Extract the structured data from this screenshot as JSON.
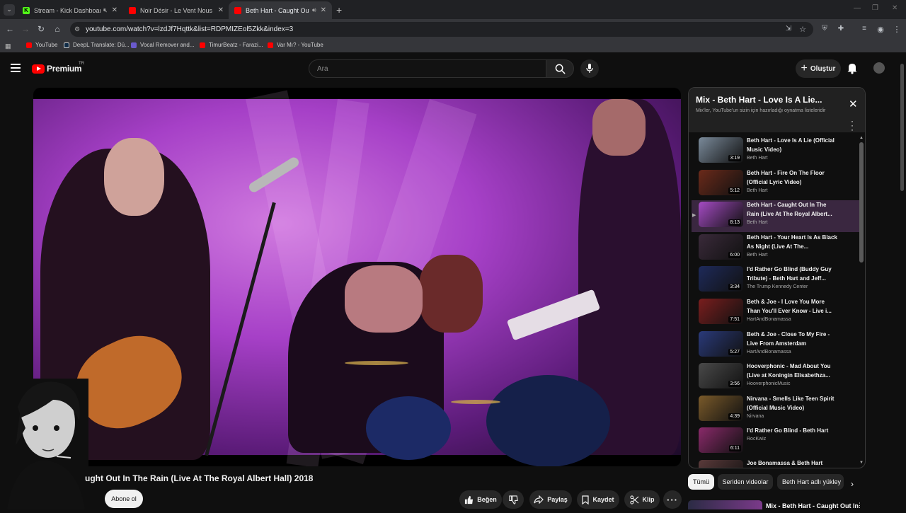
{
  "browser": {
    "tabs": [
      {
        "title": "Stream - Kick Dashboard",
        "favicon_color": "#53fc18",
        "favicon_letter": "K"
      },
      {
        "title": "Noir Désir - Le Vent Nous Porte",
        "favicon_color": "#ff0000"
      },
      {
        "title": "Beth Hart - Caught Out In The Rain",
        "favicon_color": "#ff0000",
        "active": true
      }
    ],
    "url": "youtube.com/watch?v=lzdJf7Hqttk&list=RDPMIZEol5Zkk&index=3",
    "bookmarks": [
      {
        "label": "YouTube",
        "color": "#ff0000"
      },
      {
        "label": "DeepL Translate: Dü...",
        "color": "#0f2b46"
      },
      {
        "label": "Vocal Remover and...",
        "color": "#6a5acd"
      },
      {
        "label": "TimurBeatz - Farazi...",
        "color": "#ff0000"
      },
      {
        "label": "Var Mı? - YouTube",
        "color": "#ff0000"
      }
    ]
  },
  "header": {
    "logo_text": "Premium",
    "country": "TR",
    "search_placeholder": "Ara",
    "create_label": "Oluştur"
  },
  "video": {
    "title": "ught Out In The Rain (Live At The Royal Albert Hall) 2018",
    "subscribe_label": "Abone ol",
    "actions": {
      "like": "Beğen",
      "share": "Paylaş",
      "save": "Kaydet",
      "clip": "Klip"
    }
  },
  "playlist": {
    "title": "Mix - Beth Hart - Love Is A Lie...",
    "subtitle": "Mix'ler, YouTube'un sizin için hazırladığı oynatma listeleridir",
    "items": [
      {
        "title": "Beth Hart - Love Is A Lie (Official Music Video)",
        "channel": "Beth Hart",
        "duration": "3:19",
        "thumb": "#7a8a9a"
      },
      {
        "title": "Beth Hart - Fire On The Floor (Official Lyric Video)",
        "channel": "Beth Hart",
        "duration": "5:12",
        "thumb": "#6b2a1a"
      },
      {
        "title": "Beth Hart - Caught Out In The Rain (Live At The Royal Albert...",
        "channel": "Beth Hart",
        "duration": "8:13",
        "thumb": "#a54bc4",
        "current": true
      },
      {
        "title": "Beth Hart - Your Heart Is As Black As Night (Live At The...",
        "channel": "Beth Hart",
        "duration": "6:00",
        "thumb": "#3a2a3a"
      },
      {
        "title": "I'd Rather Go Blind (Buddy Guy Tribute) - Beth Hart and Jeff...",
        "channel": "The Trump Kennedy Center",
        "duration": "3:34",
        "thumb": "#1e2a5a"
      },
      {
        "title": "Beth & Joe - I Love You More Than You'll Ever Know - Live i...",
        "channel": "HartAndBonamassa",
        "duration": "7:51",
        "thumb": "#7a1e1e"
      },
      {
        "title": "Beth & Joe - Close To My Fire - Live From Amsterdam",
        "channel": "HartAndBonamassa",
        "duration": "5:27",
        "thumb": "#2a3a7a"
      },
      {
        "title": "Hooverphonic - Mad About You (Live at Koningin Elisabethza...",
        "channel": "HooverphonicMusic",
        "duration": "3:56",
        "thumb": "#4a4a4a"
      },
      {
        "title": "Nirvana - Smells Like Teen Spirit (Official Music Video)",
        "channel": "Nirvana",
        "duration": "4:39",
        "thumb": "#7a5a2a"
      },
      {
        "title": "I'd Rather Go Blind - Beth Hart",
        "channel": "RocKwiz",
        "duration": "6:11",
        "thumb": "#8a2a6a"
      },
      {
        "title": "Joe Bonamassa & Beth Hart",
        "channel": "",
        "duration": "",
        "thumb": "#5a3a3a"
      }
    ]
  },
  "chips": [
    "Tümü",
    "Seriden videolar",
    "Beth Hart adlı yükley"
  ],
  "next_mix": {
    "title": "Mix - Beth Hart - Caught Out In"
  }
}
